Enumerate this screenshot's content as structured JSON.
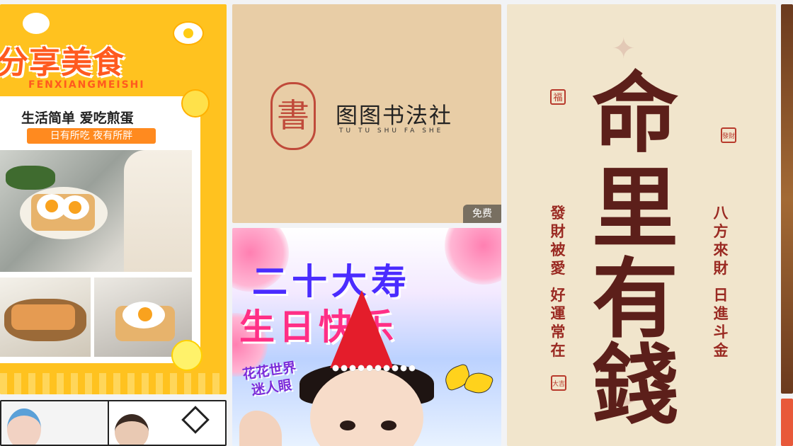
{
  "cards": {
    "food": {
      "title": "分享美食",
      "pinyin": "FENXIANGMEISHI",
      "subtitle": "生活简单 爱吃煎蛋",
      "tag": "日有所吃 夜有所胖"
    },
    "club": {
      "seal": "書",
      "name": "图图书法社",
      "latin": "TU TU SHU FA SHE",
      "badge": "免费"
    },
    "birthday": {
      "line1": "二十大寿",
      "line2": "生日快乐",
      "slogan_1": "花花世界",
      "slogan_2": "迷人眼"
    },
    "poster": {
      "big_1": "命",
      "big_2": "里",
      "big_3": "有",
      "big_4": "錢",
      "left_col_1": "發財被愛",
      "left_col_2": "好運常在",
      "right_col_1": "八方來財",
      "right_col_2": "日進斗金",
      "seal_1": "福",
      "seal_2": "發財",
      "seal_3": "大吉"
    }
  },
  "colors": {
    "food_bg": "#ffc21f",
    "food_accent": "#ff5a1f",
    "club_bg": "#e8cda6",
    "seal_red": "#c04a3a",
    "poster_bg": "#f1e5cc",
    "poster_ink": "#5c1f1a"
  }
}
